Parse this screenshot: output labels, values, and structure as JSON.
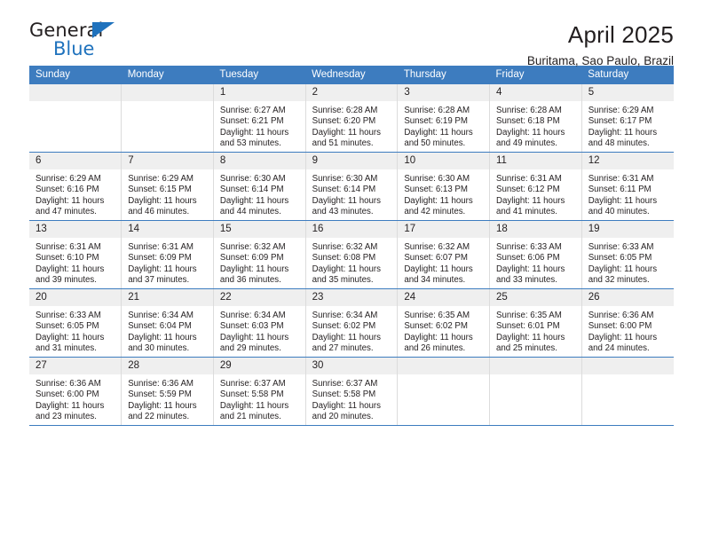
{
  "brand": {
    "name_top": "General",
    "name_bottom": "Blue",
    "accent_color": "#1f72bd"
  },
  "header": {
    "title": "April 2025",
    "subtitle": "Buritama, Sao Paulo, Brazil"
  },
  "theme": {
    "header_row_color": "#3d7cbf",
    "daynum_band_color": "#efefef",
    "text_color": "#231f20"
  },
  "weekday_headers": [
    "Sunday",
    "Monday",
    "Tuesday",
    "Wednesday",
    "Thursday",
    "Friday",
    "Saturday"
  ],
  "weeks": [
    [
      {
        "day": "",
        "sunrise": "",
        "sunset": "",
        "daylight_line1": "",
        "daylight_line2": ""
      },
      {
        "day": "",
        "sunrise": "",
        "sunset": "",
        "daylight_line1": "",
        "daylight_line2": ""
      },
      {
        "day": "1",
        "sunrise": "Sunrise: 6:27 AM",
        "sunset": "Sunset: 6:21 PM",
        "daylight_line1": "Daylight: 11 hours",
        "daylight_line2": "and 53 minutes."
      },
      {
        "day": "2",
        "sunrise": "Sunrise: 6:28 AM",
        "sunset": "Sunset: 6:20 PM",
        "daylight_line1": "Daylight: 11 hours",
        "daylight_line2": "and 51 minutes."
      },
      {
        "day": "3",
        "sunrise": "Sunrise: 6:28 AM",
        "sunset": "Sunset: 6:19 PM",
        "daylight_line1": "Daylight: 11 hours",
        "daylight_line2": "and 50 minutes."
      },
      {
        "day": "4",
        "sunrise": "Sunrise: 6:28 AM",
        "sunset": "Sunset: 6:18 PM",
        "daylight_line1": "Daylight: 11 hours",
        "daylight_line2": "and 49 minutes."
      },
      {
        "day": "5",
        "sunrise": "Sunrise: 6:29 AM",
        "sunset": "Sunset: 6:17 PM",
        "daylight_line1": "Daylight: 11 hours",
        "daylight_line2": "and 48 minutes."
      }
    ],
    [
      {
        "day": "6",
        "sunrise": "Sunrise: 6:29 AM",
        "sunset": "Sunset: 6:16 PM",
        "daylight_line1": "Daylight: 11 hours",
        "daylight_line2": "and 47 minutes."
      },
      {
        "day": "7",
        "sunrise": "Sunrise: 6:29 AM",
        "sunset": "Sunset: 6:15 PM",
        "daylight_line1": "Daylight: 11 hours",
        "daylight_line2": "and 46 minutes."
      },
      {
        "day": "8",
        "sunrise": "Sunrise: 6:30 AM",
        "sunset": "Sunset: 6:14 PM",
        "daylight_line1": "Daylight: 11 hours",
        "daylight_line2": "and 44 minutes."
      },
      {
        "day": "9",
        "sunrise": "Sunrise: 6:30 AM",
        "sunset": "Sunset: 6:14 PM",
        "daylight_line1": "Daylight: 11 hours",
        "daylight_line2": "and 43 minutes."
      },
      {
        "day": "10",
        "sunrise": "Sunrise: 6:30 AM",
        "sunset": "Sunset: 6:13 PM",
        "daylight_line1": "Daylight: 11 hours",
        "daylight_line2": "and 42 minutes."
      },
      {
        "day": "11",
        "sunrise": "Sunrise: 6:31 AM",
        "sunset": "Sunset: 6:12 PM",
        "daylight_line1": "Daylight: 11 hours",
        "daylight_line2": "and 41 minutes."
      },
      {
        "day": "12",
        "sunrise": "Sunrise: 6:31 AM",
        "sunset": "Sunset: 6:11 PM",
        "daylight_line1": "Daylight: 11 hours",
        "daylight_line2": "and 40 minutes."
      }
    ],
    [
      {
        "day": "13",
        "sunrise": "Sunrise: 6:31 AM",
        "sunset": "Sunset: 6:10 PM",
        "daylight_line1": "Daylight: 11 hours",
        "daylight_line2": "and 39 minutes."
      },
      {
        "day": "14",
        "sunrise": "Sunrise: 6:31 AM",
        "sunset": "Sunset: 6:09 PM",
        "daylight_line1": "Daylight: 11 hours",
        "daylight_line2": "and 37 minutes."
      },
      {
        "day": "15",
        "sunrise": "Sunrise: 6:32 AM",
        "sunset": "Sunset: 6:09 PM",
        "daylight_line1": "Daylight: 11 hours",
        "daylight_line2": "and 36 minutes."
      },
      {
        "day": "16",
        "sunrise": "Sunrise: 6:32 AM",
        "sunset": "Sunset: 6:08 PM",
        "daylight_line1": "Daylight: 11 hours",
        "daylight_line2": "and 35 minutes."
      },
      {
        "day": "17",
        "sunrise": "Sunrise: 6:32 AM",
        "sunset": "Sunset: 6:07 PM",
        "daylight_line1": "Daylight: 11 hours",
        "daylight_line2": "and 34 minutes."
      },
      {
        "day": "18",
        "sunrise": "Sunrise: 6:33 AM",
        "sunset": "Sunset: 6:06 PM",
        "daylight_line1": "Daylight: 11 hours",
        "daylight_line2": "and 33 minutes."
      },
      {
        "day": "19",
        "sunrise": "Sunrise: 6:33 AM",
        "sunset": "Sunset: 6:05 PM",
        "daylight_line1": "Daylight: 11 hours",
        "daylight_line2": "and 32 minutes."
      }
    ],
    [
      {
        "day": "20",
        "sunrise": "Sunrise: 6:33 AM",
        "sunset": "Sunset: 6:05 PM",
        "daylight_line1": "Daylight: 11 hours",
        "daylight_line2": "and 31 minutes."
      },
      {
        "day": "21",
        "sunrise": "Sunrise: 6:34 AM",
        "sunset": "Sunset: 6:04 PM",
        "daylight_line1": "Daylight: 11 hours",
        "daylight_line2": "and 30 minutes."
      },
      {
        "day": "22",
        "sunrise": "Sunrise: 6:34 AM",
        "sunset": "Sunset: 6:03 PM",
        "daylight_line1": "Daylight: 11 hours",
        "daylight_line2": "and 29 minutes."
      },
      {
        "day": "23",
        "sunrise": "Sunrise: 6:34 AM",
        "sunset": "Sunset: 6:02 PM",
        "daylight_line1": "Daylight: 11 hours",
        "daylight_line2": "and 27 minutes."
      },
      {
        "day": "24",
        "sunrise": "Sunrise: 6:35 AM",
        "sunset": "Sunset: 6:02 PM",
        "daylight_line1": "Daylight: 11 hours",
        "daylight_line2": "and 26 minutes."
      },
      {
        "day": "25",
        "sunrise": "Sunrise: 6:35 AM",
        "sunset": "Sunset: 6:01 PM",
        "daylight_line1": "Daylight: 11 hours",
        "daylight_line2": "and 25 minutes."
      },
      {
        "day": "26",
        "sunrise": "Sunrise: 6:36 AM",
        "sunset": "Sunset: 6:00 PM",
        "daylight_line1": "Daylight: 11 hours",
        "daylight_line2": "and 24 minutes."
      }
    ],
    [
      {
        "day": "27",
        "sunrise": "Sunrise: 6:36 AM",
        "sunset": "Sunset: 6:00 PM",
        "daylight_line1": "Daylight: 11 hours",
        "daylight_line2": "and 23 minutes."
      },
      {
        "day": "28",
        "sunrise": "Sunrise: 6:36 AM",
        "sunset": "Sunset: 5:59 PM",
        "daylight_line1": "Daylight: 11 hours",
        "daylight_line2": "and 22 minutes."
      },
      {
        "day": "29",
        "sunrise": "Sunrise: 6:37 AM",
        "sunset": "Sunset: 5:58 PM",
        "daylight_line1": "Daylight: 11 hours",
        "daylight_line2": "and 21 minutes."
      },
      {
        "day": "30",
        "sunrise": "Sunrise: 6:37 AM",
        "sunset": "Sunset: 5:58 PM",
        "daylight_line1": "Daylight: 11 hours",
        "daylight_line2": "and 20 minutes."
      },
      {
        "day": "",
        "sunrise": "",
        "sunset": "",
        "daylight_line1": "",
        "daylight_line2": ""
      },
      {
        "day": "",
        "sunrise": "",
        "sunset": "",
        "daylight_line1": "",
        "daylight_line2": ""
      },
      {
        "day": "",
        "sunrise": "",
        "sunset": "",
        "daylight_line1": "",
        "daylight_line2": ""
      }
    ]
  ]
}
